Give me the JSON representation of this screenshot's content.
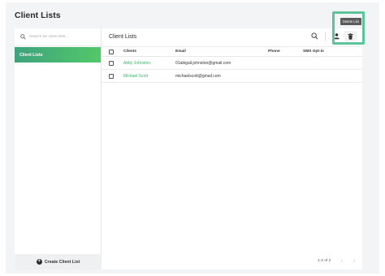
{
  "page": {
    "title": "Client Lists"
  },
  "sidebar": {
    "search_placeholder": "Search for client lists...",
    "items": [
      {
        "label": "Client Lists",
        "active": true
      }
    ],
    "create_button_label": "Create Client List"
  },
  "main": {
    "title": "Client Lists",
    "columns": [
      "Clients",
      "Email",
      "Phone",
      "SMS Opt-in"
    ],
    "rows": [
      {
        "client": "Abby Johnston",
        "email": "01abigail.johnston@gmail.com",
        "phone": "",
        "sms_opt_in": ""
      },
      {
        "client": "Michael Scott",
        "email": "michaelscott@gmail.com",
        "phone": "",
        "sms_opt_in": ""
      }
    ],
    "pagination": "1-2 of 2"
  },
  "toolbar": {
    "delete_tooltip": "Delete List"
  },
  "colors": {
    "accent_green": "#3bb56a",
    "highlight": "#5cc39a",
    "gradient_start": "#3ea37d",
    "gradient_end": "#52c86a"
  },
  "icons": [
    "search-icon",
    "user-icon",
    "trash-icon",
    "plus-circle-icon",
    "chevron-left-icon",
    "chevron-right-icon"
  ]
}
